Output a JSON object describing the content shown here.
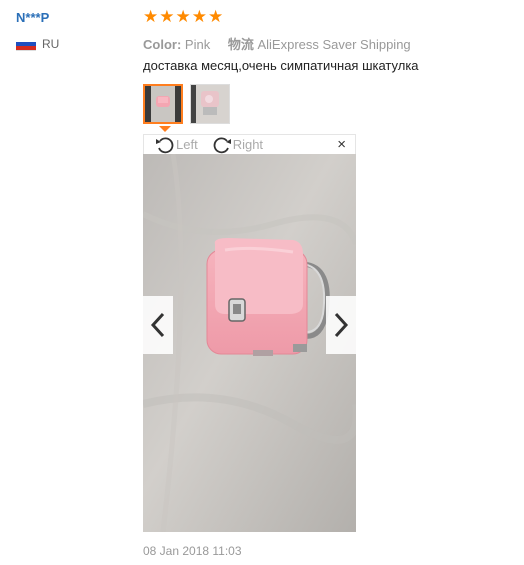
{
  "reviewer": {
    "name": "N***P",
    "country_code": "RU",
    "flag_colors": [
      "#ffffff",
      "#1f4fbf",
      "#d52b1e"
    ]
  },
  "rating": {
    "stars": 5,
    "max": 5,
    "star_color": "#ff8a00"
  },
  "order_info": {
    "color_label": "Color:",
    "color_value": "Pink",
    "shipping_label": "物流",
    "shipping_value": "AliExpress Saver Shipping"
  },
  "feedback_text": "доставка месяц,очень симпатичная шкатулка",
  "thumbnails": [
    {
      "name": "photo-1",
      "active": true
    },
    {
      "name": "photo-2",
      "active": false
    }
  ],
  "viewer": {
    "rotate_left_label": "Left",
    "rotate_right_label": "Right",
    "close_label": "×",
    "prev_icon": "chevron-left-icon",
    "next_icon": "chevron-right-icon"
  },
  "date": "08 Jan 2018 11:03",
  "accent_color": "#ff7e1f",
  "link_color": "#2a6fb8"
}
